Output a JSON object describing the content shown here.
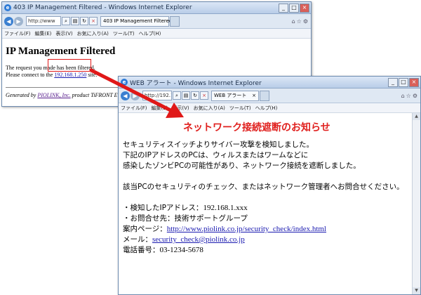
{
  "window1": {
    "title": "403 IP Management Filtered - Windows Internet Explorer",
    "address": "http://www",
    "tab_label": "403 IP Management Filtered",
    "menu": [
      "ファイル(F)",
      "編集(E)",
      "表示(V)",
      "お気に入り(A)",
      "ツール(T)",
      "ヘルプ(H)"
    ],
    "heading": "IP Management Filtered",
    "line1": "The request you made has been filtered.",
    "line2_pre": "Please connect to the",
    "line2_ip": "192.168.1.250",
    "line2_post": "site.",
    "generated_pre": "Generated by",
    "generated_link": "PIOLINK, Inc.",
    "generated_post": "product TiFRONT E"
  },
  "window2": {
    "title": "WEB アラート - Windows Internet Explorer",
    "address": "http://192.1",
    "tab_label": "WEB アラート",
    "menu": [
      "ファイル(F)",
      "編集(E)",
      "表示(V)",
      "お気に入り(A)",
      "ツール(T)",
      "ヘルプ(H)"
    ],
    "notice_title": "ネットワーク接続遮断のお知らせ",
    "para1": [
      "セキュリティスイッチよりサイバー攻撃を検知しました。",
      "下記のIPアドレスのPCは、ウィルスまたはワームなどに",
      "感染したゾンビPCの可能性があり、ネットワーク接続を遮断しました。"
    ],
    "para2": "該当PCのセキュリティのチェック、またはネットワーク管理者へお問合せください。",
    "detected_label": "・検知したIPアドレス：",
    "detected_ip": "192.168.1.xxx",
    "contact": "・お問合せ先：技術サポートグループ",
    "guide_label": "案内ページ：",
    "guide_url": "http://www.piolink.co.jp/security_check/index.html",
    "mail_label": "メール：",
    "mail": "security_check@piolink.co.jp",
    "phone_label": "電話番号：",
    "phone": "03-1234-5678"
  },
  "colors": {
    "alert_red": "#e0201e",
    "arrow_red": "#e01818"
  }
}
